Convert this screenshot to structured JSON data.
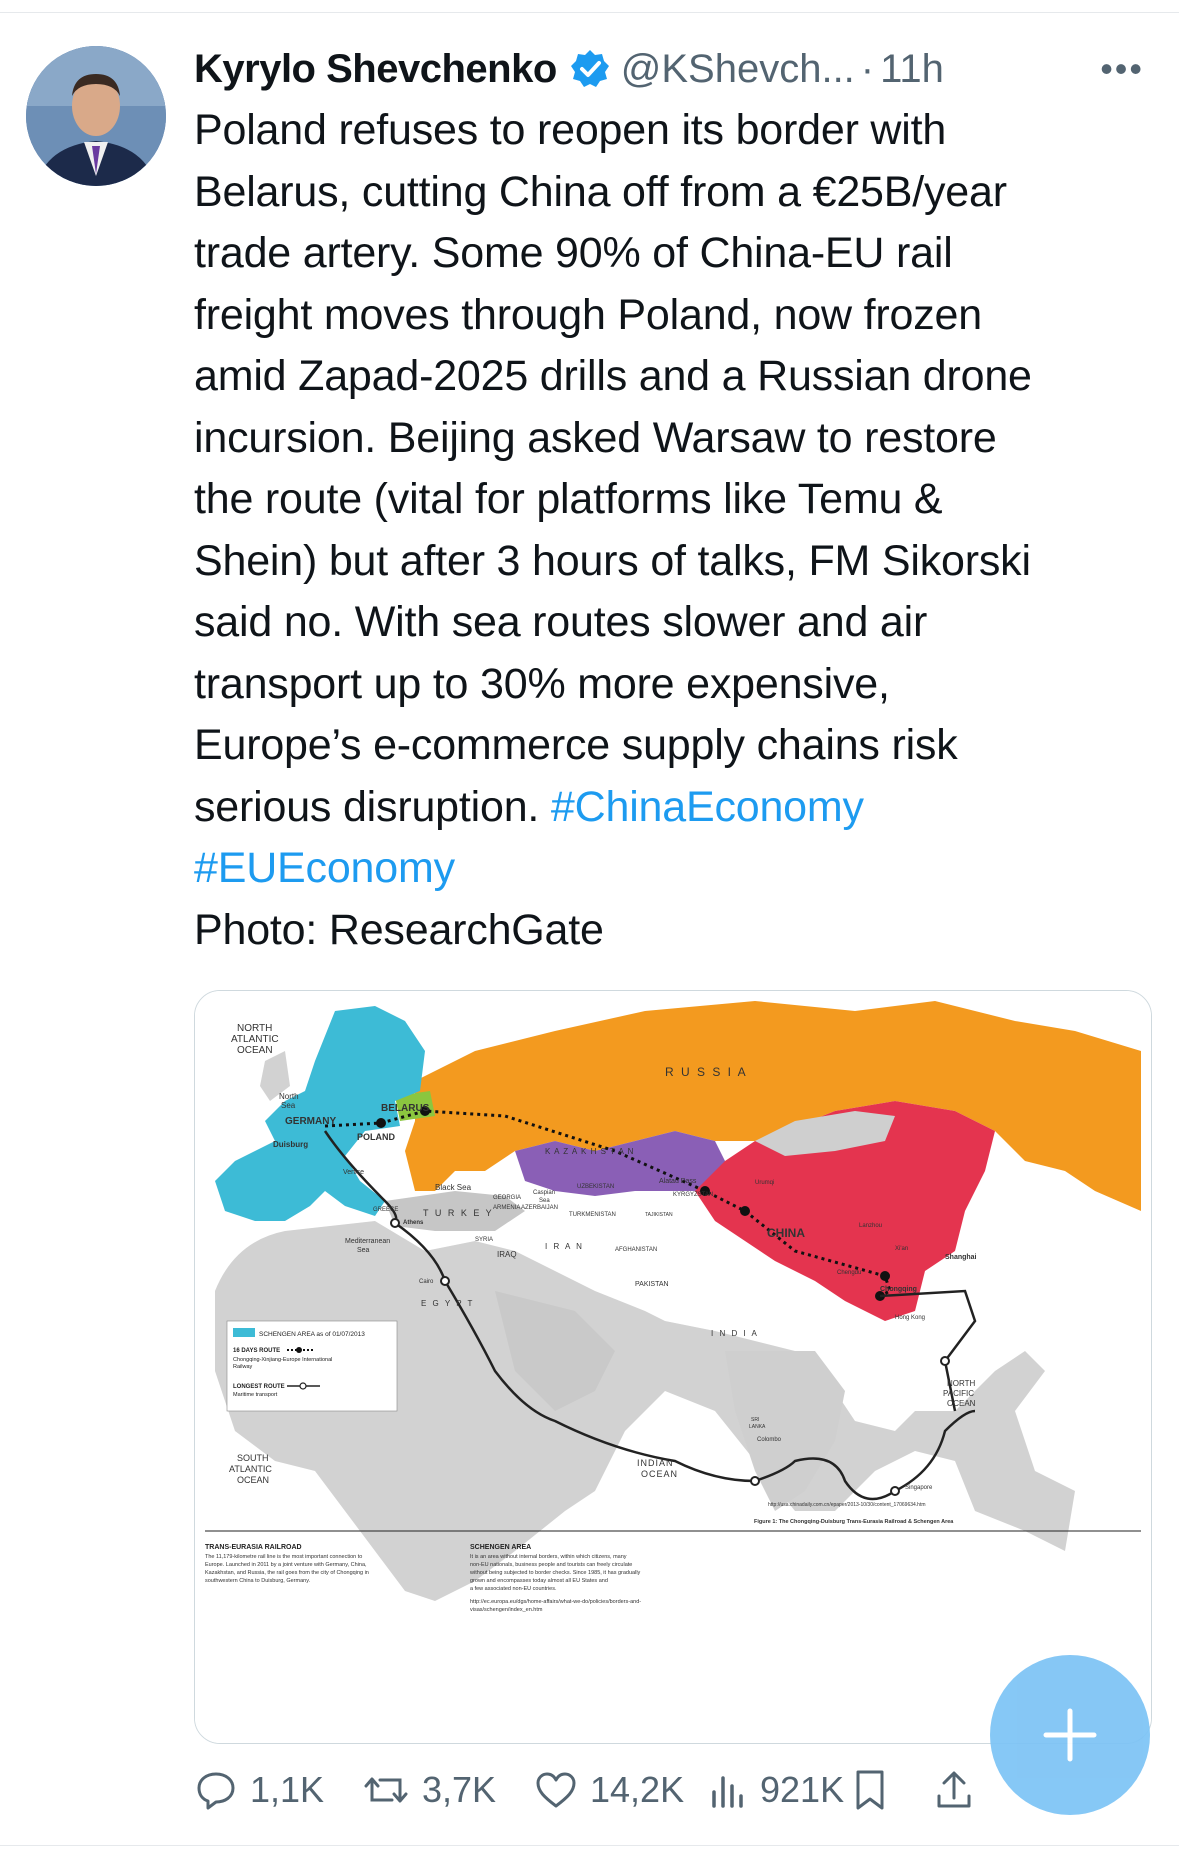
{
  "post": {
    "author_name": "Kyrylo Shevchenko",
    "handle": "@KShevch...",
    "separator": "·",
    "time": "11h",
    "more": "•••",
    "text_before": "Poland refuses to reopen its border with\nBelarus, cutting China off from a €25B/year\ntrade artery. Some 90% of China-EU rail\nfreight moves through Poland, now frozen\namid Zapad-2025 drills and a Russian drone\nincursion. Beijing asked Warsaw to restore\nthe route (vital for platforms like Temu &\nShein) but after 3 hours of talks, FM Sikorski\nsaid no. With sea routes slower and air\ntransport up to 30% more expensive,\nEurope’s e-commerce supply chains risk\nserious disruption. ",
    "hashtag1": "#ChinaEconomy",
    "hashtag2": "#EUEconomy",
    "photo_credit": "Photo: ResearchGate"
  },
  "map": {
    "labels": {
      "north_atlantic": [
        "NORTH",
        "ATLANTIC",
        "OCEAN"
      ],
      "north_sea": [
        "North",
        "Sea"
      ],
      "russia": "R U S S I A",
      "belarus": "BELARUS",
      "germany": "GERMANY",
      "poland": "POLAND",
      "duisburg": "Duisburg",
      "kazakhstan": "K A Z A K H S T A N",
      "venice": "Venice",
      "black_sea": "Black Sea",
      "georgia": "GEORGIA",
      "armenia": "ARMENIA",
      "azerbaijan": "AZERBAIJAN",
      "caspian": [
        "Caspian",
        "Sea"
      ],
      "uzbekistan": "UZBEKISTAN",
      "alatau": "Alatau Pass",
      "kyrgyzstan": "KYRGYZSTAN",
      "urumqi": "Urumqi",
      "turkmenistan": "TURKMENISTAN",
      "tajikistan": "TAJIKISTAN",
      "turkey": "T U R K E Y",
      "greece": "GREECE",
      "athens": "Athens",
      "mediterranean": [
        "Mediterranean",
        "Sea"
      ],
      "syria": "SYRIA",
      "iraq": "IRAQ",
      "iran": "I R A N",
      "afghanistan": "AFGHANISTAN",
      "lanzhou": "Lanzhou",
      "china": "CHINA",
      "xian": "Xi'an",
      "shanghai": "Shanghai",
      "chengdu": "Chengdu",
      "chongqing": "Chongqing",
      "cairo": "Cairo",
      "egypt": "E G Y P T",
      "pakistan": "PAKISTAN",
      "hongkong": "Hong Kong",
      "india": "I N D I A",
      "north_pacific": [
        "NORTH",
        "PACIFIC",
        "OCEAN"
      ],
      "sri_lanka": [
        "SRI",
        "LANKA"
      ],
      "colombo": "Colombo",
      "south_atlantic": [
        "SOUTH",
        "ATLANTIC",
        "OCEAN"
      ],
      "indian_ocean": [
        "INDIAN",
        "OCEAN"
      ],
      "singapore": "Singapore",
      "url": "http://usa.chinadaily.com.cn/epaper/2013-10/30/content_17069634.htm",
      "figure_caption": "Figure 1: The Chongqing-Duisburg Trans-Eurasia Railroad & Schengen Area"
    },
    "legend": {
      "schengen": "SCHENGEN AREA as of 01/07/2013",
      "route16": "16 DAYS ROUTE",
      "route16_desc": [
        "Chongqing-Xinjiang-Europe International",
        "Railway"
      ],
      "longest": "LONGEST ROUTE",
      "longest_desc": "Maritime transport"
    },
    "notes": {
      "rail_title": "TRANS-EURASIA RAILROAD",
      "rail_text": [
        "The 11,179-kilometre rail line is the most important connection to",
        "Europe. Launched in 2011 by a joint venture with Germany, China,",
        "Kazakhstan, and Russia, the rail goes from the city of Chongqing in",
        "southwestern China to Duisburg, Germany."
      ],
      "schengen_title": "SCHENGEN AREA",
      "schengen_text": [
        "It is an area without internal borders, within which citizens, many",
        "non-EU nationals, business people and tourists can freely circulate",
        "without being subjected to border checks. Since 1985, it has gradually",
        "grown and encompasses today almost all EU States and",
        "a few associated non-EU countries."
      ],
      "schengen_url": [
        "http://ec.europa.eu/dgs/home-affairs/what-we-do/policies/borders-and-",
        "visas/schengen/index_en.htm"
      ]
    },
    "colors": {
      "schengen": "#3dbbd6",
      "russia": "#f39a1f",
      "china": "#e4344f",
      "kazakhstan": "#8a5fb6",
      "belarus": "#8bc63f",
      "land": "#d6d6d6",
      "sea": "#ffffff"
    }
  },
  "actions": {
    "reply_count": "1,1K",
    "repost_count": "3,7K",
    "like_count": "14,2K",
    "views_count": "921K"
  },
  "icons": [
    "verified-badge-icon",
    "more-icon",
    "reply-icon",
    "repost-icon",
    "like-icon",
    "views-icon",
    "bookmark-icon",
    "share-icon",
    "compose-plus-icon"
  ]
}
